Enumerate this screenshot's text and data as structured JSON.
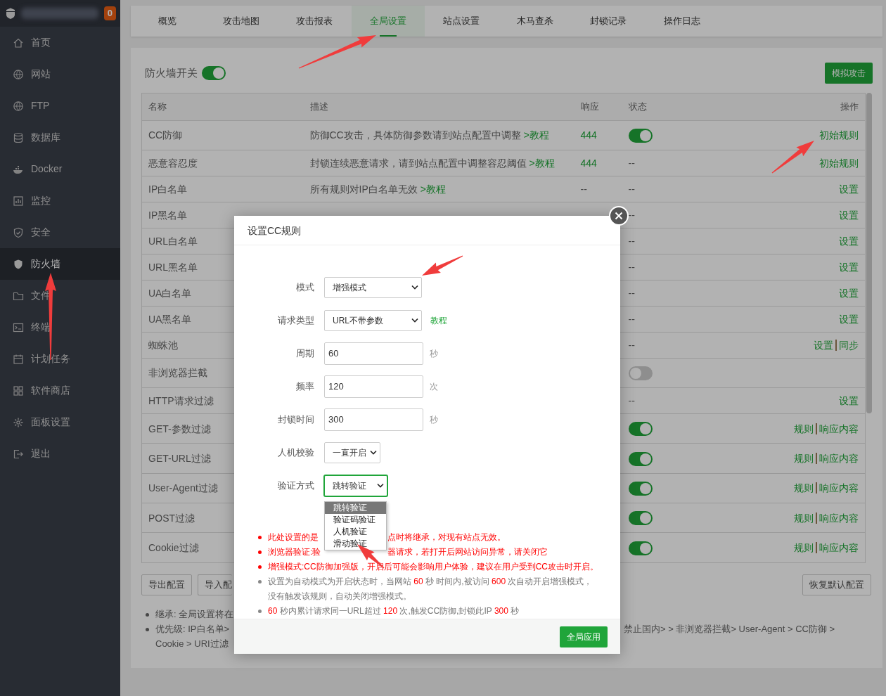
{
  "sidebar": {
    "badge": "0",
    "items": [
      {
        "label": "首页",
        "selected": false
      },
      {
        "label": "网站",
        "selected": false
      },
      {
        "label": "FTP",
        "selected": false
      },
      {
        "label": "数据库",
        "selected": false
      },
      {
        "label": "Docker",
        "selected": false
      },
      {
        "label": "监控",
        "selected": false
      },
      {
        "label": "安全",
        "selected": false
      },
      {
        "label": "防火墙",
        "selected": true
      },
      {
        "label": "文件",
        "selected": false
      },
      {
        "label": "终端",
        "selected": false
      },
      {
        "label": "计划任务",
        "selected": false
      },
      {
        "label": "软件商店",
        "selected": false
      },
      {
        "label": "面板设置",
        "selected": false
      },
      {
        "label": "退出",
        "selected": false
      }
    ]
  },
  "tabs": [
    {
      "label": "概览",
      "selected": false
    },
    {
      "label": "攻击地图",
      "selected": false
    },
    {
      "label": "攻击报表",
      "selected": false
    },
    {
      "label": "全局设置",
      "selected": true
    },
    {
      "label": "站点设置",
      "selected": false
    },
    {
      "label": "木马查杀",
      "selected": false
    },
    {
      "label": "封锁记录",
      "selected": false
    },
    {
      "label": "操作日志",
      "selected": false
    }
  ],
  "firewall_switch": {
    "label": "防火墙开关",
    "on": true
  },
  "simulate_button": "模拟攻击",
  "table": {
    "columns": [
      "名称",
      "描述",
      "响应",
      "状态",
      "操作"
    ],
    "rows": [
      {
        "name": "CC防御",
        "description": [
          {
            "kind": "text",
            "text": "防御CC攻击，具体防御参数请到站点配置中调整"
          },
          {
            "kind": "link",
            "text": ">教程"
          }
        ],
        "response": "444",
        "status": {
          "kind": "toggle",
          "on": true
        },
        "actions": [
          "初始规则"
        ]
      },
      {
        "name": "恶意容忍度",
        "description": [
          {
            "kind": "text",
            "text": "封锁连续恶意请求，请到站点配置中调整容忍阈值"
          },
          {
            "kind": "link",
            "text": ">教程"
          }
        ],
        "response": "444",
        "status": {
          "kind": "text",
          "text": "--"
        },
        "actions": [
          "初始规则"
        ]
      },
      {
        "name": "IP白名单",
        "description": [
          {
            "kind": "text",
            "text": "所有规则对IP白名单无效"
          },
          {
            "kind": "link",
            "text": ">教程"
          }
        ],
        "response": "--",
        "status": {
          "kind": "text",
          "text": "--"
        },
        "actions": [
          "设置"
        ]
      },
      {
        "name": "IP黑名单",
        "status": {
          "kind": "text",
          "text": "--"
        },
        "actions": [
          "设置"
        ]
      },
      {
        "name": "URL白名单",
        "status": {
          "kind": "text",
          "text": "--"
        },
        "actions": [
          "设置"
        ]
      },
      {
        "name": "URL黑名单",
        "status": {
          "kind": "text",
          "text": "--"
        },
        "actions": [
          "设置"
        ]
      },
      {
        "name": "UA白名单",
        "status": {
          "kind": "text",
          "text": "--"
        },
        "actions": [
          "设置"
        ]
      },
      {
        "name": "UA黑名单",
        "status": {
          "kind": "text",
          "text": "--"
        },
        "actions": [
          "设置"
        ]
      },
      {
        "name": "蜘蛛池",
        "status": {
          "kind": "text",
          "text": "--"
        },
        "actions": [
          "设置",
          "同步"
        ]
      },
      {
        "name": "非浏览器拦截",
        "status": {
          "kind": "toggle",
          "on": false
        }
      },
      {
        "name": "HTTP请求过滤",
        "status": {
          "kind": "text",
          "text": "--"
        },
        "actions": [
          "设置"
        ]
      },
      {
        "name": "GET-参数过滤",
        "status": {
          "kind": "toggle",
          "on": true
        },
        "actions": [
          "规则",
          "响应内容"
        ]
      },
      {
        "name": "GET-URL过滤",
        "status": {
          "kind": "toggle",
          "on": true
        },
        "actions": [
          "规则",
          "响应内容"
        ]
      },
      {
        "name": "User-Agent过滤",
        "status": {
          "kind": "toggle",
          "on": true
        },
        "actions": [
          "规则",
          "响应内容"
        ]
      },
      {
        "name": "POST过滤",
        "status": {
          "kind": "toggle",
          "on": true
        },
        "actions": [
          "规则",
          "响应内容"
        ]
      },
      {
        "name": "Cookie过滤",
        "status": {
          "kind": "toggle",
          "on": true
        },
        "actions": [
          "规则",
          "响应内容"
        ]
      }
    ]
  },
  "bottom_buttons": [
    "导出配置",
    "导入配"
  ],
  "restore_button": "恢复默认配置",
  "bottom_notes": [
    {
      "lines": [
        [
          {
            "kind": "text",
            "text": "继承: 全局设置将在"
          }
        ]
      ]
    },
    {
      "lines": [
        [
          {
            "kind": "text",
            "text": "优先级: IP白名单>"
          },
          {
            "kind": "covered"
          },
          {
            "kind": "text",
            "text": "禁止国内> > 非浏览器拦截> User-Agent > CC防御 >"
          }
        ],
        [
          {
            "kind": "text",
            "text": "Cookie > URI过滤"
          }
        ]
      ]
    }
  ],
  "modal": {
    "title": "设置CC规则",
    "fields": [
      {
        "label": "模式",
        "kind": "select",
        "value": "增强模式"
      },
      {
        "label": "请求类型",
        "kind": "select",
        "value": "URL不带参数",
        "link": "教程"
      },
      {
        "label": "周期",
        "kind": "input",
        "value": "60",
        "unit": "秒"
      },
      {
        "label": "频率",
        "kind": "input",
        "value": "120",
        "unit": "次"
      },
      {
        "label": "封锁时间",
        "kind": "input",
        "value": "300",
        "unit": "秒"
      },
      {
        "label": "人机校验",
        "kind": "select",
        "value": "一直开启"
      },
      {
        "label": "验证方式",
        "kind": "select",
        "value": "跳转验证",
        "focused": true,
        "options": [
          {
            "label": "跳转验证",
            "selected": true
          },
          {
            "label": "验证码验证",
            "selected": false
          },
          {
            "label": "人机验证",
            "selected": false
          },
          {
            "label": "滑动验证",
            "selected": false
          }
        ]
      }
    ],
    "notes": [
      {
        "kind": "warning",
        "lines": [
          [
            {
              "kind": "text",
              "text": "此处设置的是"
            },
            {
              "kind": "covered"
            },
            {
              "kind": "text",
              "text": "点时将继承，对现有站点无效。"
            }
          ]
        ]
      },
      {
        "kind": "warning",
        "lines": [
          [
            {
              "kind": "text",
              "text": "浏览器验证:验"
            },
            {
              "kind": "covered"
            },
            {
              "kind": "text",
              "text": "器请求，若打开后网站访问异常，请关闭它"
            }
          ]
        ]
      },
      {
        "kind": "warning",
        "lines": [
          [
            {
              "kind": "text",
              "text": "增强模式:CC防御加强版，开启后可能会影响用户体验，建议在用户受到CC攻击时开启。"
            }
          ]
        ]
      },
      {
        "kind": "info",
        "lines": [
          [
            {
              "kind": "text",
              "text": "设置为自动模式为开启状态时，当网站 "
            },
            {
              "kind": "number",
              "text": "60"
            },
            {
              "kind": "text",
              "text": " 秒 时间内,被访问 "
            },
            {
              "kind": "number",
              "text": "600"
            },
            {
              "kind": "text",
              "text": " 次自动开启增强模式，"
            }
          ],
          [
            {
              "kind": "text",
              "text": "没有触发该规则，自动关闭增强模式。"
            }
          ]
        ]
      },
      {
        "kind": "info",
        "lines": [
          [
            {
              "kind": "number",
              "text": "60"
            },
            {
              "kind": "text",
              "text": " 秒内累计请求同一URL超过 "
            },
            {
              "kind": "number",
              "text": "120"
            },
            {
              "kind": "text",
              "text": " 次,触发CC防御,封锁此IP "
            },
            {
              "kind": "number",
              "text": "300"
            },
            {
              "kind": "text",
              "text": " 秒"
            }
          ]
        ]
      }
    ],
    "apply_button": "全局应用"
  }
}
